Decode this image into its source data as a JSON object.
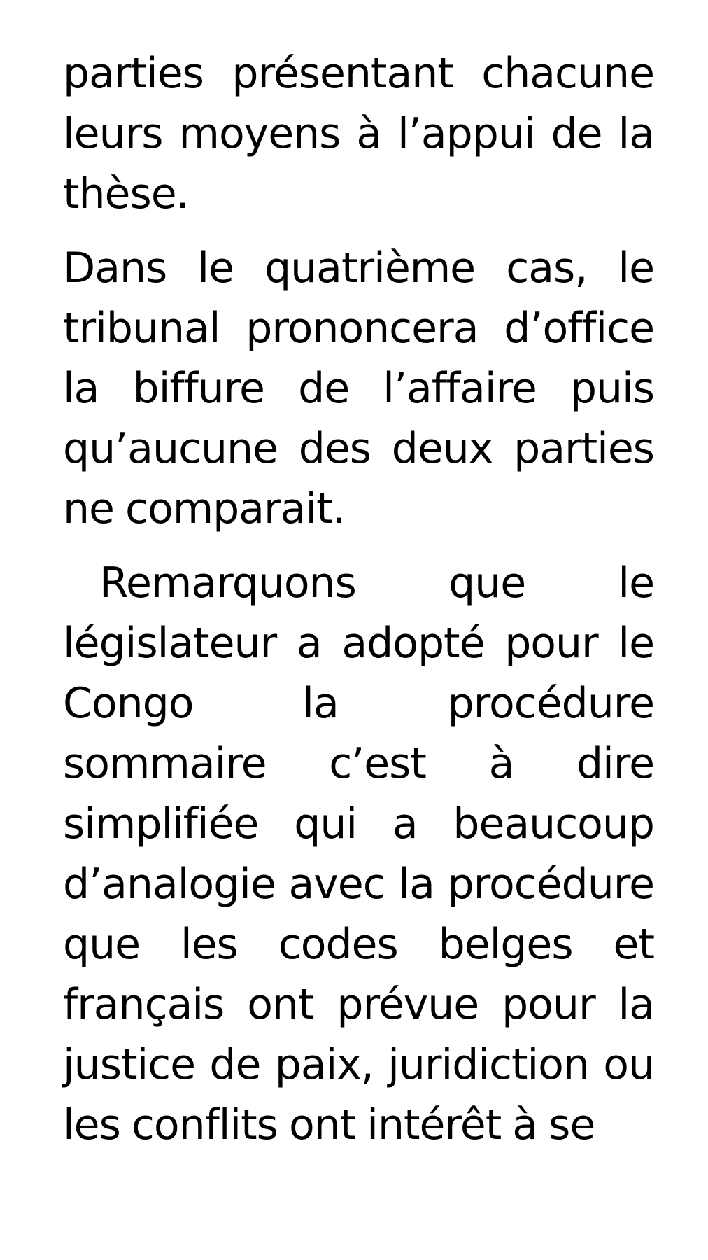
{
  "document": {
    "paragraphs": [
      "parties présentant chacune leurs moyens à l’appui de la thèse.",
      "Dans le quatrième cas, le tribunal prononcera d’office la biffure de l’affaire puis qu’aucune des deux parties ne comparait.",
      "Remarquons que le législateur a adopté pour le Congo la procédure sommaire c’est à dire simplifiée qui a beaucoup d’analogie avec la procédure que les codes belges et français ont prévue pour la justice de paix, juridiction ou les conflits ont intérêt  à se"
    ]
  }
}
